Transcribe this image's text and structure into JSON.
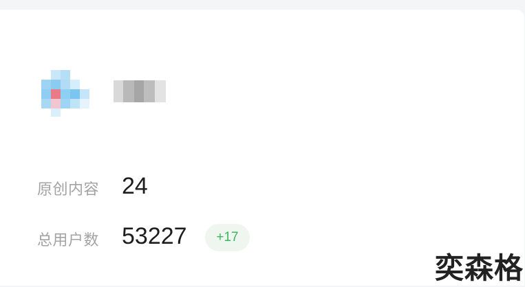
{
  "profile": {
    "avatar_alt": "",
    "username": ""
  },
  "stats": {
    "original_content": {
      "label": "原创内容",
      "value": "24"
    },
    "total_users": {
      "label": "总用户数",
      "value": "53227",
      "delta": "+17"
    }
  },
  "watermark": "奕森格",
  "colors": {
    "page_background": "#f4f5f7",
    "card_background": "#ffffff",
    "label_text": "#a3a3a3",
    "value_text": "#1d1d1f",
    "delta_text": "#3bb85c",
    "delta_background": "#eef6ef"
  }
}
